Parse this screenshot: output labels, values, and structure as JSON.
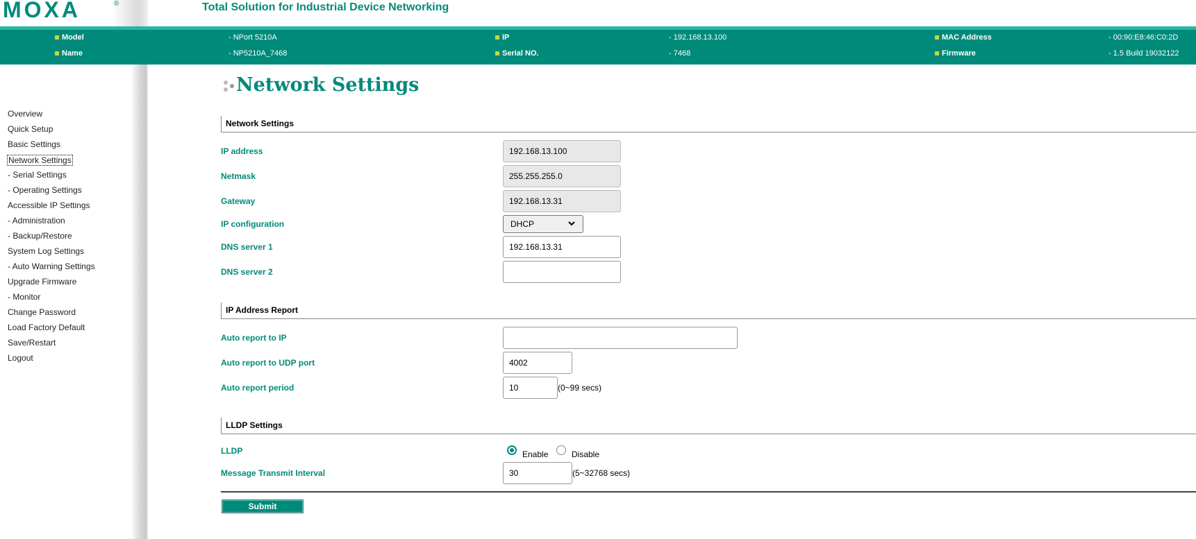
{
  "header": {
    "logo_text": "MOXA",
    "logo_reg": "®",
    "tagline": "Total Solution for Industrial Device Networking"
  },
  "device_info": {
    "model_label": "Model",
    "model_value": "- NPort 5210A",
    "name_label": "Name",
    "name_value": "- NP5210A_7468",
    "ip_label": "IP",
    "ip_value": "- 192.168.13.100",
    "serial_label": "Serial NO.",
    "serial_value": "- 7468",
    "mac_label": "MAC Address",
    "mac_value": "- 00:90:E8:46:C0:2D",
    "firmware_label": "Firmware",
    "firmware_value": "- 1.5 Build 19032122"
  },
  "sidebar": {
    "items": [
      {
        "label": "Overview"
      },
      {
        "label": "Quick Setup"
      },
      {
        "label": "Basic Settings"
      },
      {
        "label": "Network Settings",
        "active": true
      },
      {
        "label": "- Serial Settings"
      },
      {
        "label": "- Operating Settings"
      },
      {
        "label": "Accessible IP Settings"
      },
      {
        "label": "- Administration"
      },
      {
        "label": "- Backup/Restore"
      },
      {
        "label": "System Log Settings"
      },
      {
        "label": "- Auto Warning Settings"
      },
      {
        "label": "Upgrade Firmware"
      },
      {
        "label": "- Monitor"
      },
      {
        "label": "Change Password"
      },
      {
        "label": "Load Factory Default"
      },
      {
        "label": "Save/Restart"
      },
      {
        "label": "Logout"
      }
    ]
  },
  "page_title": "Network Settings",
  "network": {
    "section_title": "Network Settings",
    "ip_label": "IP address",
    "ip_value": "192.168.13.100",
    "netmask_label": "Netmask",
    "netmask_value": "255.255.255.0",
    "gateway_label": "Gateway",
    "gateway_value": "192.168.13.31",
    "ipconfig_label": "IP configuration",
    "ipconfig_value": "DHCP",
    "dns1_label": "DNS server 1",
    "dns1_value": "192.168.13.31",
    "dns2_label": "DNS server 2",
    "dns2_value": ""
  },
  "ip_report": {
    "section_title": "IP Address Report",
    "auto_ip_label": "Auto report to IP",
    "auto_ip_value": "",
    "udp_label": "Auto report to UDP port",
    "udp_value": "4002",
    "period_label": "Auto report period",
    "period_value": "10",
    "period_unit": "(0~99 secs)"
  },
  "lldp": {
    "section_title": "LLDP Settings",
    "lldp_label": "LLDP",
    "enable_label": "Enable",
    "disable_label": "Disable",
    "selected": "enable",
    "interval_label": "Message Transmit Interval",
    "interval_value": "30",
    "interval_unit": "(5~32768 secs)"
  },
  "submit_label": "Submit"
}
